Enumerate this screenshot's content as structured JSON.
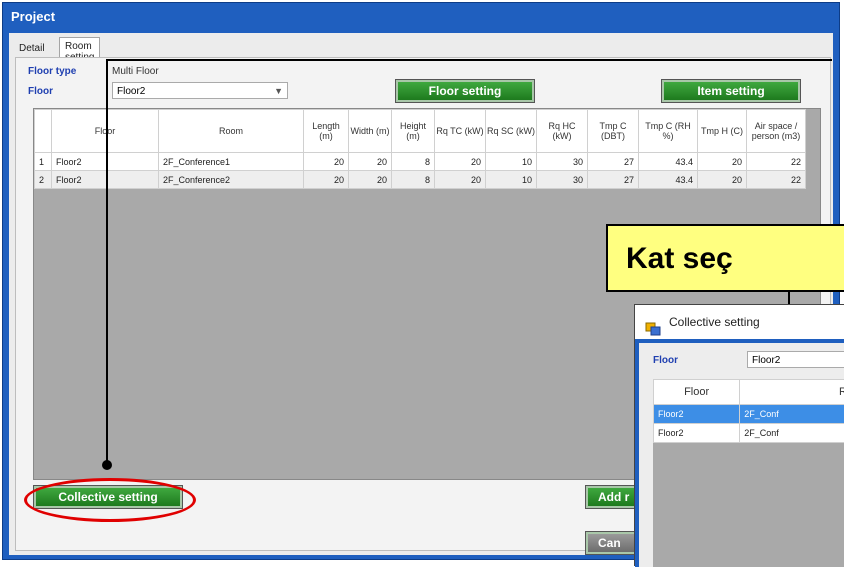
{
  "window": {
    "title": "Project"
  },
  "tabs": [
    {
      "label": "Detail"
    },
    {
      "label": "Room setting"
    }
  ],
  "panel": {
    "floor_type_label": "Floor type",
    "floor_type_value": "Multi Floor",
    "floor_label": "Floor",
    "floor_value": "Floor2",
    "floor_setting_btn": "Floor setting",
    "item_setting_btn": "Item setting"
  },
  "table": {
    "headers": [
      "",
      "Floor",
      "Room",
      "Length (m)",
      "Width (m)",
      "Height (m)",
      "Rq TC (kW)",
      "Rq SC (kW)",
      "Rq HC (kW)",
      "Tmp C (DBT)",
      "Tmp C (RH %)",
      "Tmp H (C)",
      "Air space / person (m3)"
    ],
    "rows": [
      [
        "1",
        "Floor2",
        "2F_Conference1",
        "20",
        "20",
        "8",
        "20",
        "10",
        "30",
        "27",
        "43.4",
        "20",
        "22"
      ],
      [
        "2",
        "Floor2",
        "2F_Conference2",
        "20",
        "20",
        "8",
        "20",
        "10",
        "30",
        "27",
        "43.4",
        "20",
        "22"
      ]
    ]
  },
  "bottom": {
    "collective_btn": "Collective setting",
    "add_btn": "Add r",
    "cancel_btn": "Can"
  },
  "callout": {
    "text": "Kat seç"
  },
  "dialog": {
    "title": "Collective setting",
    "floor_label": "Floor",
    "floor_value": "Floor2",
    "headers": [
      "Floor",
      "R"
    ],
    "rows": [
      [
        "Floor2",
        "2F_Conf"
      ],
      [
        "Floor2",
        "2F_Conf"
      ]
    ]
  },
  "colors": {
    "accent_green": "#2e8b2e",
    "title_blue": "#1f5fbf",
    "highlight_red": "#e00000",
    "callout_yellow": "#ffff80"
  }
}
